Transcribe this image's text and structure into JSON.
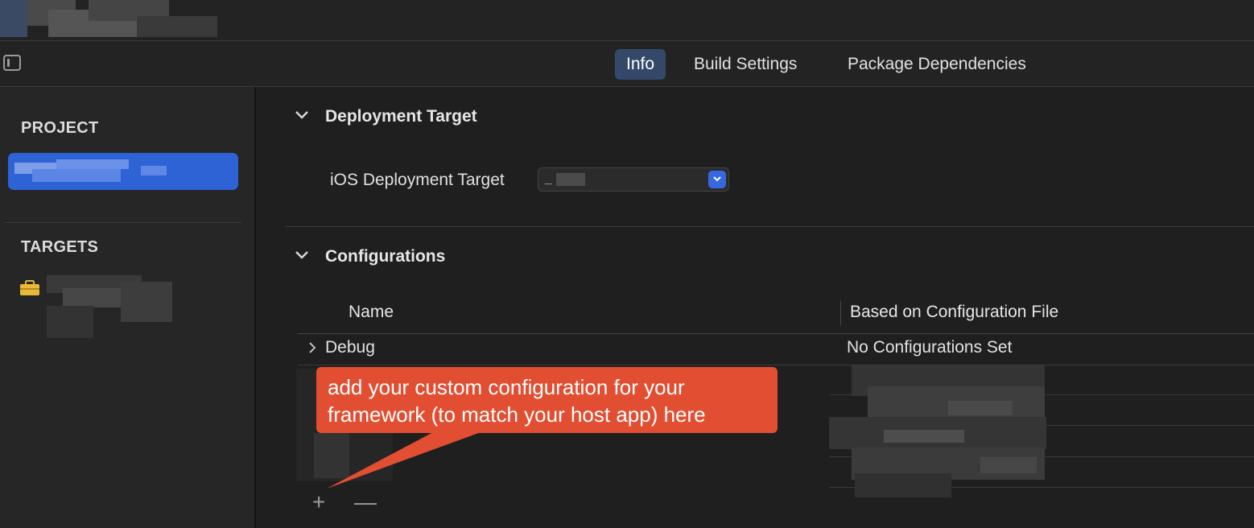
{
  "toolbar": {
    "tabs": [
      {
        "label": "Info",
        "active": true
      },
      {
        "label": "Build Settings",
        "active": false
      },
      {
        "label": "Package Dependencies",
        "active": false
      }
    ]
  },
  "sidebar": {
    "project_header": "PROJECT",
    "targets_header": "TARGETS",
    "selection_color": "#2e63d6"
  },
  "deployment": {
    "title": "Deployment Target",
    "ios_label": "iOS Deployment Target",
    "ios_value": "_"
  },
  "configurations": {
    "title": "Configurations",
    "columns": [
      "Name",
      "Based on Configuration File"
    ],
    "rows": [
      {
        "name": "Debug",
        "file": "No Configurations Set"
      }
    ],
    "add_symbol": "+",
    "remove_symbol": "—"
  },
  "callout": {
    "text": "add your custom configuration for your framework (to match your host app) here",
    "color": "#e24e31"
  },
  "icons": [
    "sidebar-toggle-icon",
    "briefcase-icon",
    "chevron-down-icon",
    "chevron-right-icon",
    "plus-icon",
    "minus-icon"
  ]
}
